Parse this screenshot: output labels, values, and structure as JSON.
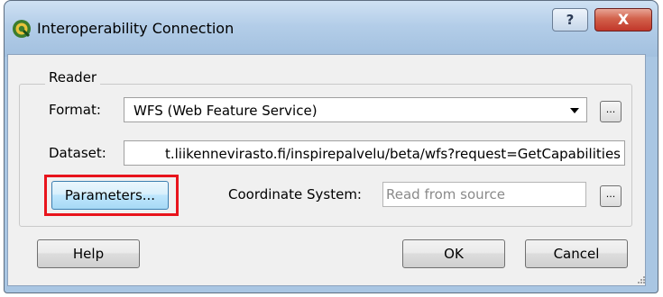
{
  "window": {
    "title": "Interoperability Connection",
    "help_glyph": "?",
    "close_glyph": "X"
  },
  "reader": {
    "group_label": "Reader",
    "format_label": "Format:",
    "format_value": "WFS (Web Feature Service)",
    "dataset_label": "Dataset:",
    "dataset_value": "t.liikennevirasto.fi/inspirepalvelu/beta/wfs?request=GetCapabilities",
    "browse_label": "...",
    "parameters_label": "Parameters...",
    "coordinate_system_label": "Coordinate System:",
    "coordinate_system_placeholder": "Read from source"
  },
  "footer": {
    "help_label": "Help",
    "ok_label": "OK",
    "cancel_label": "Cancel"
  },
  "colors": {
    "highlight": "#e8141c",
    "close_button": "#c1372a",
    "title_bar": "#b3cde8"
  }
}
